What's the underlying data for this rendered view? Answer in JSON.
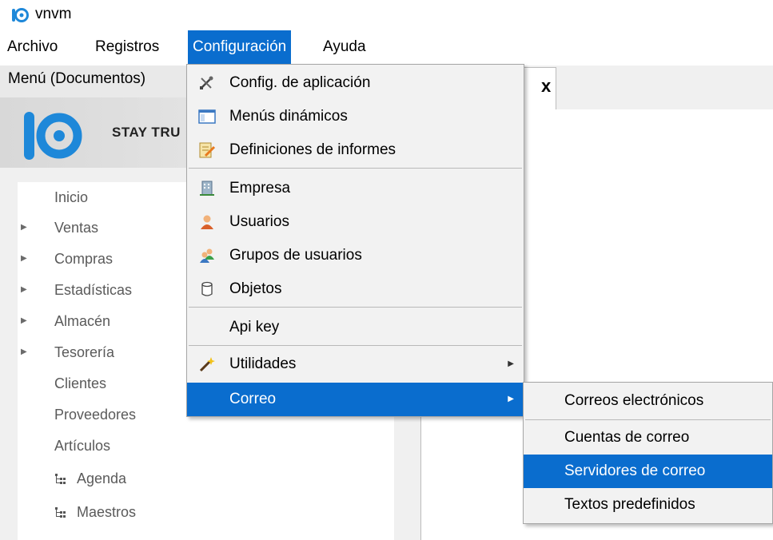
{
  "app": {
    "title": "vnvm",
    "accent": "#0a6dce",
    "brand_color": "#1e88d9"
  },
  "menubar": {
    "items": [
      {
        "label": "Archivo"
      },
      {
        "label": "Registros"
      },
      {
        "label": "Configuración",
        "active": true
      },
      {
        "label": "Ayuda"
      }
    ]
  },
  "left_panel": {
    "title": "Menú (Documentos)",
    "brand_text": "STAY TRU",
    "nav": [
      {
        "label": "Inicio",
        "expandable": false
      },
      {
        "label": "Ventas",
        "expandable": true
      },
      {
        "label": "Compras",
        "expandable": true
      },
      {
        "label": "Estadísticas",
        "expandable": true
      },
      {
        "label": "Almacén",
        "expandable": true
      },
      {
        "label": "Tesorería",
        "expandable": true
      },
      {
        "label": "Clientes",
        "expandable": false
      },
      {
        "label": "Proveedores",
        "expandable": false
      },
      {
        "label": "Artículos",
        "expandable": false
      },
      {
        "label": "Agenda",
        "icon": "tree-icon"
      },
      {
        "label": "Maestros",
        "icon": "tree-icon"
      }
    ]
  },
  "document_tab": {
    "close_glyph": "x"
  },
  "config_menu": {
    "items": [
      {
        "label": "Config. de aplicación",
        "icon": "tools-icon"
      },
      {
        "label": "Menús dinámicos",
        "icon": "window-icon"
      },
      {
        "label": "Definiciones de informes",
        "icon": "report-icon"
      },
      {
        "label": "Empresa",
        "icon": "building-icon"
      },
      {
        "label": "Usuarios",
        "icon": "user-icon"
      },
      {
        "label": "Grupos de usuarios",
        "icon": "users-group-icon"
      },
      {
        "label": "Objetos",
        "icon": "cylinder-icon"
      },
      {
        "label": "Api key"
      },
      {
        "label": "Utilidades",
        "icon": "magic-wand-icon",
        "submenu": true
      },
      {
        "label": "Correo",
        "submenu": true,
        "active": true
      }
    ]
  },
  "correo_submenu": {
    "items": [
      {
        "label": "Correos electrónicos"
      },
      {
        "label": "Cuentas de correo"
      },
      {
        "label": "Servidores de correo",
        "active": true
      },
      {
        "label": "Textos predefinidos"
      }
    ]
  }
}
